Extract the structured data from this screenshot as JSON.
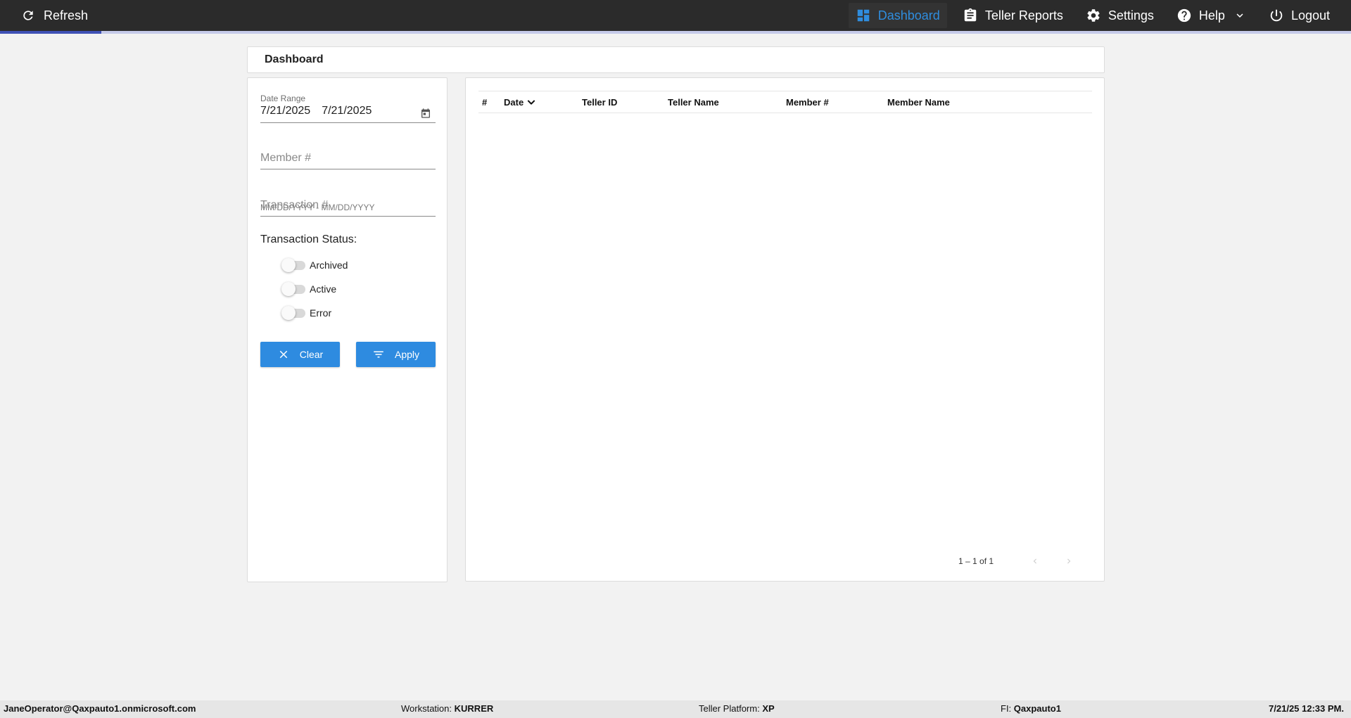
{
  "topbar": {
    "refresh_label": "Refresh",
    "page_load_progress": 0.075,
    "nav": {
      "dashboard": "Dashboard",
      "teller_reports": "Teller Reports",
      "settings": "Settings",
      "help": "Help",
      "logout": "Logout"
    },
    "active_color": "#2f8dde"
  },
  "page_title": "Dashboard",
  "filters": {
    "date_range_label": "Date Range",
    "date_start": "7/21/2025",
    "date_end": "7/21/2025",
    "date_hint": "MM/DD/YYYY - MM/DD/YYYY",
    "member_placeholder": "Member #",
    "transaction_placeholder": "Transaction #",
    "status_label": "Transaction Status:",
    "statuses": [
      {
        "label": "Archived",
        "on": false
      },
      {
        "label": "Active",
        "on": false
      },
      {
        "label": "Error",
        "on": false
      }
    ],
    "clear_label": "Clear",
    "apply_label": "Apply",
    "button_color": "#2e8be0"
  },
  "table": {
    "columns": [
      "#",
      "Date",
      "Teller ID",
      "Teller Name",
      "Member #",
      "Member Name"
    ],
    "sort_column": "Date",
    "rows": [],
    "paginator_range": "1 – 1 of 1"
  },
  "statusbar": {
    "user": "JaneOperator@Qaxpauto1.onmicrosoft.com",
    "workstation_label": "Workstation:",
    "workstation": "KURRER",
    "platform_label": "Teller Platform:",
    "platform": "XP",
    "fi_label": "FI:",
    "fi": "Qaxpauto1",
    "datetime": "7/21/25 12:33 PM."
  }
}
